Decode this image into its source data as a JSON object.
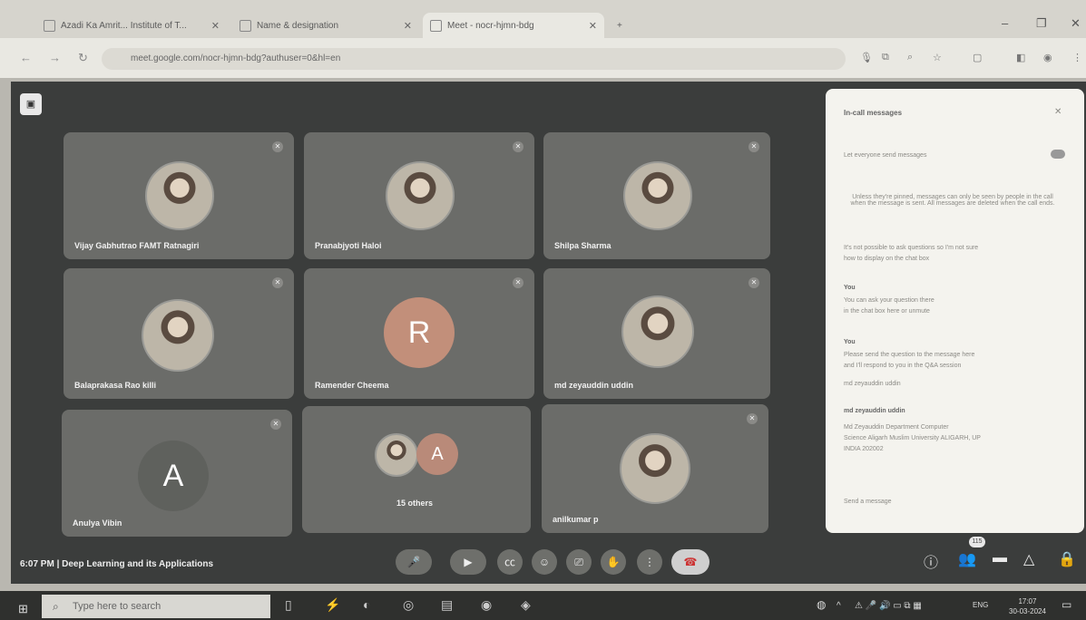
{
  "browser": {
    "tabs": [
      {
        "label": "Azadi Ka Amrit... Institute of T..."
      },
      {
        "label": "Name & designation"
      },
      {
        "label": "Meet - nocr-hjmn-bdg"
      }
    ],
    "url": "meet.google.com/nocr-hjmn-bdg?authuser=0&hl=en",
    "new_tab": "+"
  },
  "meet": {
    "participants": [
      {
        "name": "Vijay Gabhutrao FAMT Ratnagiri",
        "avatar": "photo"
      },
      {
        "name": "Pranabjyoti Haloi",
        "avatar": "photo"
      },
      {
        "name": "Shilpa Sharma",
        "avatar": "photo"
      },
      {
        "name": "Balaprakasa Rao killi",
        "avatar": "photo"
      },
      {
        "name": "Ramender Cheema",
        "avatar": "letter",
        "letter": "R",
        "color": "#c28f7a"
      },
      {
        "name": "md zeyauddin uddin",
        "avatar": "photo"
      },
      {
        "name": "Anulya Vibin",
        "avatar": "letter",
        "letter": "A",
        "color": "#5f615d"
      },
      {
        "name": "15 others",
        "avatar": "letter",
        "letter": "A",
        "color": "#b98a79"
      },
      {
        "name": "anilkumar p",
        "avatar": "photo"
      }
    ],
    "meeting_info": "6:07 PM | Deep Learning and its Applications",
    "participant_badge": "115",
    "chat": {
      "title": "In-call messages",
      "toggle_label": "Let everyone send messages",
      "notice": "Unless they're pinned, messages can only be seen by people in the call when the message is sent. All messages are deleted when the call ends.",
      "messages": [
        {
          "sender": "",
          "text": "It's not possible to ask questions so I'm not sure",
          "text2": "how to display on the chat box"
        },
        {
          "sender": "You",
          "text": "You can ask your question there",
          "text2": "in the chat box here or unmute"
        },
        {
          "sender": "You",
          "text": "Please send the question to the message here",
          "text2": "and I'll respond to you in the Q&A session"
        },
        {
          "sender": "",
          "text": "md zeyauddin uddin",
          "text2": ""
        },
        {
          "sender": "md zeyauddin uddin",
          "text": "Md Zeyauddin     Department Computer",
          "text2": "Science   Aligarh Muslim University ALIGARH, UP",
          "text3": "INDIA 202002"
        }
      ],
      "input_placeholder": "Send a message"
    }
  },
  "taskbar": {
    "search_placeholder": "Type here to search",
    "language": "ENG",
    "time": "17:07",
    "date": "30-03-2024"
  }
}
